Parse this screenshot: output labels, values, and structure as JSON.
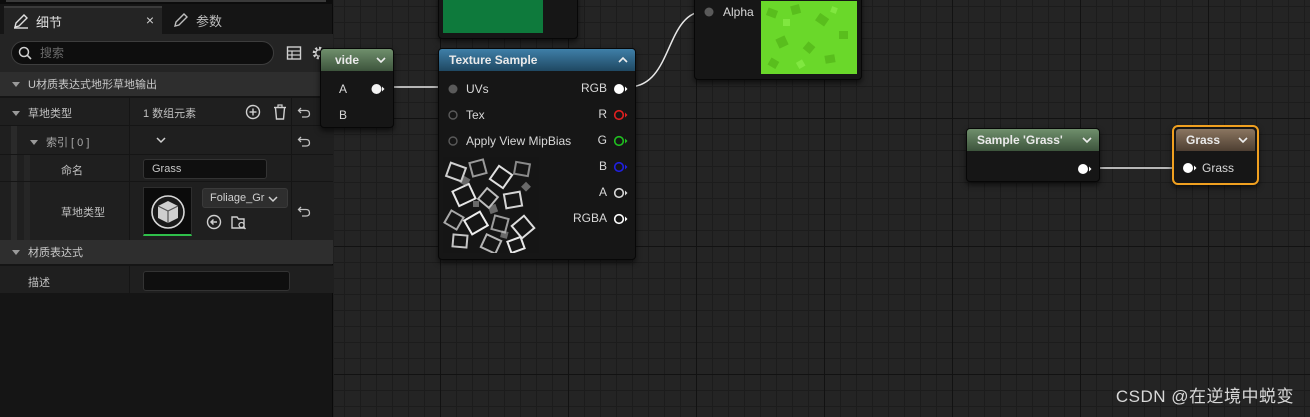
{
  "details_panel": {
    "tabs": [
      {
        "label": "细节",
        "icon": "pencil-icon",
        "close": "×"
      },
      {
        "label": "参数",
        "icon": "pencil-icon"
      }
    ],
    "search": {
      "placeholder": "搜索"
    },
    "sections": {
      "landscape_output": "U材质表达式地形草地输出",
      "material_expression": "材质表达式"
    },
    "grass_types": {
      "label": "草地类型",
      "value": "1 数组元素",
      "index": {
        "label": "索引 [ 0 ]"
      },
      "name": {
        "label": "命名",
        "value": "Grass"
      },
      "grass_type": {
        "label": "草地类型",
        "asset": "Foliage_Gr"
      }
    },
    "description": {
      "label": "描述",
      "value": ""
    }
  },
  "graph": {
    "divide_node": {
      "title": "vide",
      "pins": [
        "A",
        "B"
      ]
    },
    "texture_sample": {
      "title": "Texture Sample",
      "inputs": [
        "UVs",
        "Tex",
        "Apply View MipBias"
      ],
      "outputs": [
        {
          "label": "RGB",
          "color": "#ffffff"
        },
        {
          "label": "R",
          "color": "#e02020"
        },
        {
          "label": "G",
          "color": "#20c020"
        },
        {
          "label": "B",
          "color": "#2020e0"
        },
        {
          "label": "A",
          "color": "#d8d8d8"
        },
        {
          "label": "RGBA",
          "color": "#ffffff"
        }
      ]
    },
    "lerp_node": {
      "pin": "Alpha"
    },
    "sample_grass": {
      "title": "Sample 'Grass'"
    },
    "grass_output": {
      "title": "Grass",
      "pin": "Grass"
    }
  },
  "colors": {
    "texture_header": "#2f6a8f",
    "sample_header": "#5b7a5a",
    "output_header": "#6e5a48",
    "selection": "#f0a020",
    "green_preview": "#66d422"
  },
  "watermark": "CSDN @在逆境中蜕变"
}
